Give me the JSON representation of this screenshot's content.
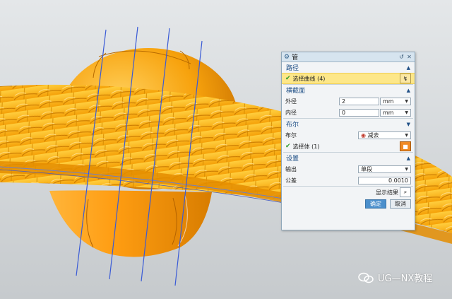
{
  "dialog": {
    "title": "管",
    "path_section": {
      "heading": "路径",
      "select_curve_label": "选择曲线 (4)"
    },
    "cross_section": {
      "heading": "横截面",
      "outer_diameter_label": "外径",
      "outer_diameter_value": "2",
      "outer_diameter_unit": "mm",
      "inner_diameter_label": "内径",
      "inner_diameter_value": "0",
      "inner_diameter_unit": "mm"
    },
    "boolean_section": {
      "heading": "布尔",
      "boolean_label": "布尔",
      "boolean_value": "减去",
      "select_body_label": "选择体 (1)"
    },
    "settings_section": {
      "heading": "设置",
      "output_label": "输出",
      "output_value": "单段",
      "tolerance_label": "公差",
      "tolerance_value": "0.0010"
    },
    "show_result_label": "显示结果",
    "ok_label": "确定",
    "cancel_label": "取消"
  },
  "watermark": {
    "text": "UG—NX教程"
  },
  "colors": {
    "accent": "#1f4f86",
    "selection_row": "#fde789",
    "model_orange": "#f7a70f",
    "sphere_orange": "#f4950b",
    "path_curves": "#3a5bd6",
    "ok_button": "#4b8fcc"
  },
  "icons": {
    "dialog": "gear-icon",
    "reset": "reset-icon",
    "close": "close-icon",
    "curve_select": "curve-select-icon",
    "boolean": "subtract-icon",
    "body_select": "solid-body-icon",
    "show_result": "magnifier-icon",
    "watermark": "wechat-icon"
  }
}
